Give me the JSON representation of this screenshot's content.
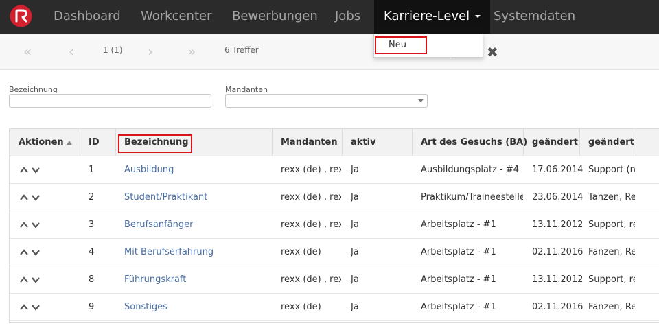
{
  "nav": {
    "items": [
      "Dashboard",
      "Workcenter",
      "Bewerbungen",
      "Jobs",
      "Karriere-Level",
      "Systemdaten"
    ],
    "active": "Karriere-Level"
  },
  "dropdown": {
    "item": "Neu"
  },
  "pager": {
    "first_icon": "«",
    "prev_icon": "‹",
    "page": "1 (1)",
    "next_icon": "›",
    "last_icon": "»",
    "count": "6 Treffer"
  },
  "filters": {
    "bezeichnung_label": "Bezeichnung",
    "mandanten_label": "Mandanten"
  },
  "table": {
    "headers": {
      "aktionen": "Aktionen",
      "id": "ID",
      "bezeichnung": "Bezeichnung",
      "mandanten": "Mandanten",
      "aktiv": "aktiv",
      "art": "Art des Gesuchs (BA)",
      "geaendert_am": "geändert am",
      "geaendert_von": "geändert von"
    },
    "rows": [
      {
        "id": "1",
        "bezeichnung": "Ausbildung",
        "mandanten": "rexx (de) , rexx",
        "aktiv": "Ja",
        "art": "Ausbildungsplatz - #4",
        "am": "17.06.2014",
        "von": "Support (nl"
      },
      {
        "id": "2",
        "bezeichnung": "Student/Praktikant",
        "mandanten": "rexx (de) , rexx",
        "aktiv": "Ja",
        "art": "Praktikum/Traineestelle -",
        "am": "23.06.2014",
        "von": "Tanzen, Ret"
      },
      {
        "id": "3",
        "bezeichnung": "Berufsanfänger",
        "mandanten": "rexx (de) , rexx",
        "aktiv": "Ja",
        "art": "Arbeitsplatz - #1",
        "am": "13.11.2012",
        "von": "Support, re"
      },
      {
        "id": "4",
        "bezeichnung": "Mit Berufserfahrung",
        "mandanten": "rexx (de)",
        "aktiv": "Ja",
        "art": "Arbeitsplatz - #1",
        "am": "02.11.2016",
        "von": "Fanzen, Ret"
      },
      {
        "id": "8",
        "bezeichnung": "Führungskraft",
        "mandanten": "rexx (de) , rexx",
        "aktiv": "Ja",
        "art": "Arbeitsplatz - #1",
        "am": "13.11.2012",
        "von": "Support, re"
      },
      {
        "id": "9",
        "bezeichnung": "Sonstiges",
        "mandanten": "rexx (de)",
        "aktiv": "Ja",
        "art": "Arbeitsplatz - #1",
        "am": "02.11.2016",
        "von": "Fanzen, Ret"
      }
    ]
  },
  "colors": {
    "nav_bg": "#2b2b2b",
    "nav_active_bg": "#111111",
    "link": "#4a6fa5",
    "highlight": "#d9151a",
    "logo_red": "#d2202f"
  }
}
